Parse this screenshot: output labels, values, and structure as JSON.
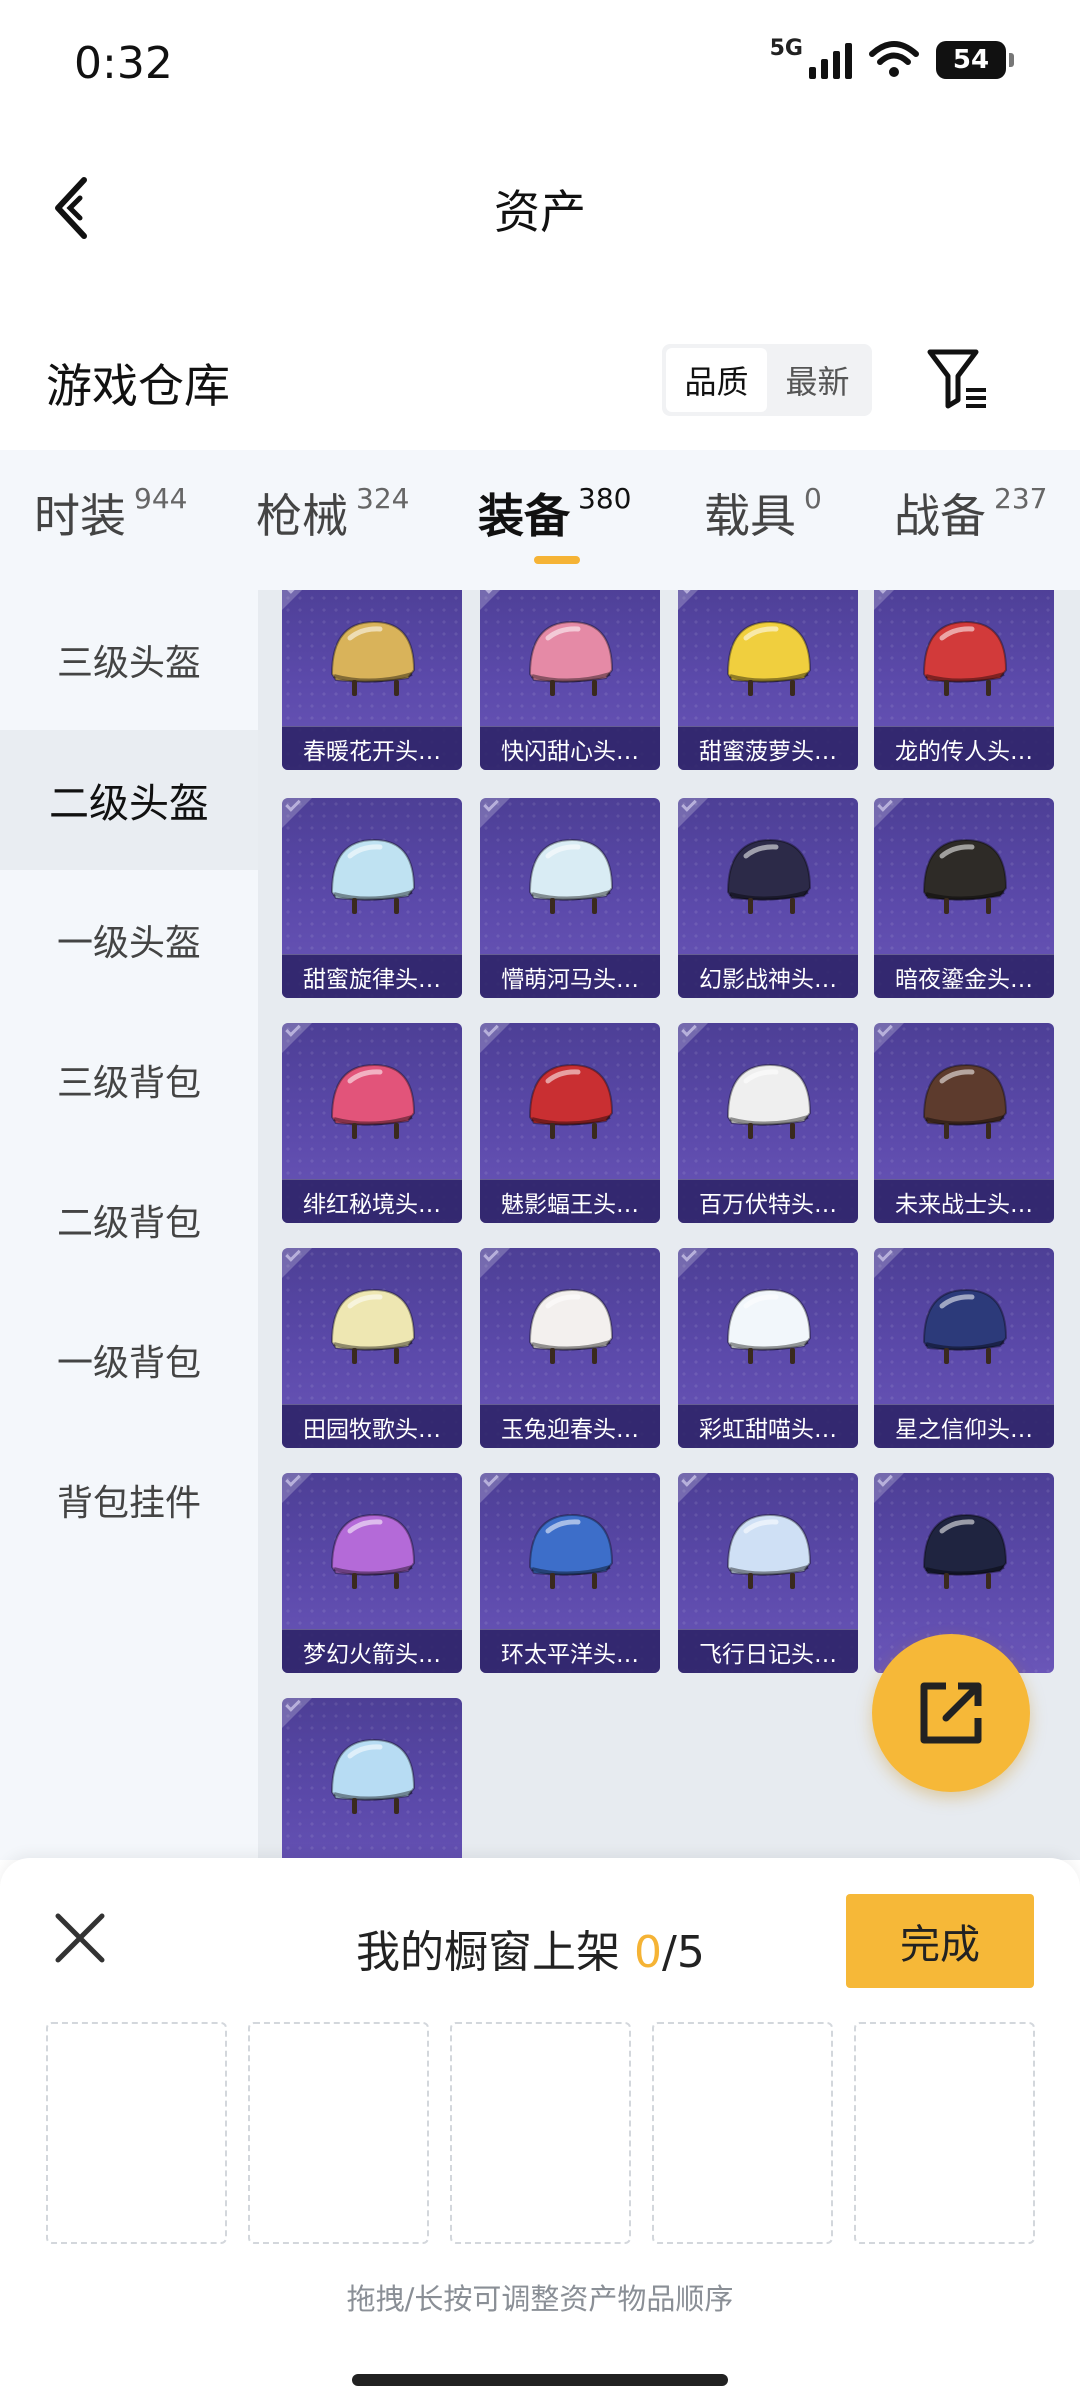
{
  "status_bar": {
    "time": "0:32",
    "network": "5G",
    "battery": "54"
  },
  "nav": {
    "title": "资产"
  },
  "warehouse": {
    "title": "游戏仓库",
    "sort_options": [
      "品质",
      "最新"
    ],
    "active_sort": "品质"
  },
  "category_tabs": [
    {
      "label": "时装",
      "count": "944"
    },
    {
      "label": "枪械",
      "count": "324"
    },
    {
      "label": "装备",
      "count": "380",
      "active": true
    },
    {
      "label": "载具",
      "count": "0"
    },
    {
      "label": "战备",
      "count": "237"
    }
  ],
  "side_nav": [
    {
      "label": "三级头盔"
    },
    {
      "label": "二级头盔",
      "active": true
    },
    {
      "label": "一级头盔"
    },
    {
      "label": "三级背包"
    },
    {
      "label": "二级背包"
    },
    {
      "label": "一级背包"
    },
    {
      "label": "背包挂件"
    }
  ],
  "items": [
    {
      "name": "春暖花开头…",
      "color": "#d9b35a"
    },
    {
      "name": "快闪甜心头…",
      "color": "#e58aa6"
    },
    {
      "name": "甜蜜菠萝头…",
      "color": "#f0cf3e"
    },
    {
      "name": "龙的传人头…",
      "color": "#d23a3a"
    },
    {
      "name": "甜蜜旋律头…",
      "color": "#bfe2f2"
    },
    {
      "name": "懵萌河马头…",
      "color": "#d9ecf4"
    },
    {
      "name": "幻影战神头…",
      "color": "#2c2a48"
    },
    {
      "name": "暗夜鎏金头…",
      "color": "#2e2b27"
    },
    {
      "name": "绯红秘境头…",
      "color": "#e2547a"
    },
    {
      "name": "魅影蝠王头…",
      "color": "#c92f32"
    },
    {
      "name": "百万伏特头…",
      "color": "#efefef"
    },
    {
      "name": "未来战士头…",
      "color": "#5d3b2d"
    },
    {
      "name": "田园牧歌头…",
      "color": "#eee7b2"
    },
    {
      "name": "玉兔迎春头…",
      "color": "#f3f0ee"
    },
    {
      "name": "彩虹甜喵头…",
      "color": "#f2f7fb"
    },
    {
      "name": "星之信仰头…",
      "color": "#2c3a7a"
    },
    {
      "name": "梦幻火箭头…",
      "color": "#b46ad8"
    },
    {
      "name": "环太平洋头…",
      "color": "#3d6ec9"
    },
    {
      "name": "飞行日记头…",
      "color": "#cfe0f5"
    },
    {
      "name": "",
      "color": "#1f2440"
    },
    {
      "name": "",
      "color": "#b7dcf3"
    }
  ],
  "showcase": {
    "title_prefix": "我的橱窗上架 ",
    "current": "0",
    "total": "/5",
    "done_label": "完成",
    "hint": "拖拽/长按可调整资产物品顺序",
    "slot_count": 5
  },
  "icons": {
    "back": "chevron-left-icon",
    "filter": "funnel-icon",
    "fab": "share-external-icon",
    "close": "close-icon"
  },
  "colors": {
    "accent": "#f6b838",
    "card_bg": "#5c4aab"
  }
}
